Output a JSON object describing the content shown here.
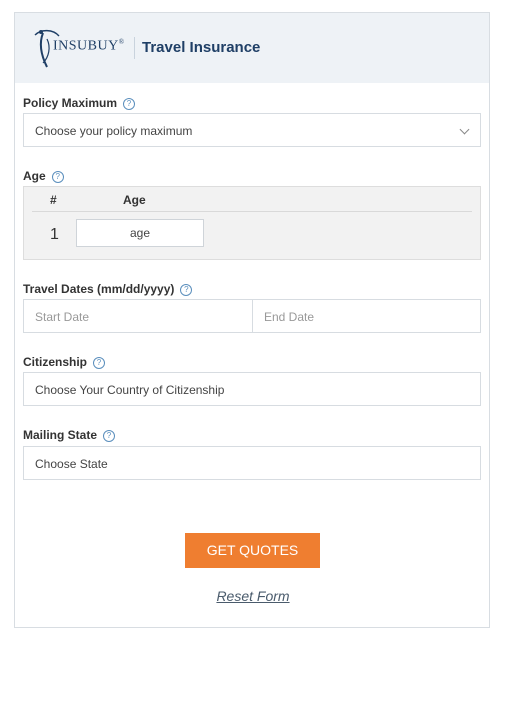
{
  "header": {
    "brand": "INSUBUY",
    "brand_mark": "®",
    "title": "Travel Insurance"
  },
  "form": {
    "policy_maximum": {
      "label": "Policy Maximum",
      "value": "Choose your policy maximum"
    },
    "age": {
      "label": "Age",
      "col_number": "#",
      "col_age": "Age",
      "rows": [
        {
          "number": "1",
          "placeholder": "age"
        }
      ]
    },
    "travel_dates": {
      "label": "Travel Dates (mm/dd/yyyy)",
      "start_placeholder": "Start Date",
      "end_placeholder": "End Date"
    },
    "citizenship": {
      "label": "Citizenship",
      "value": "Choose Your Country of Citizenship"
    },
    "mailing_state": {
      "label": "Mailing State",
      "value": "Choose State"
    },
    "help_glyph": "?",
    "submit_label": "GET QUOTES",
    "reset_label": "Reset Form"
  },
  "colors": {
    "brand": "#1f3f66",
    "accent": "#ef7e30",
    "header_bg": "#eef2f6"
  },
  "icons": [
    "insubuy-logo-icon",
    "help-icon",
    "chevron-down-icon"
  ]
}
